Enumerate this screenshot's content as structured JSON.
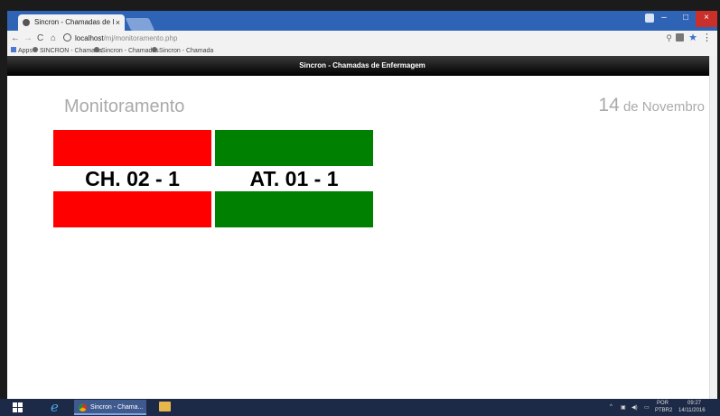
{
  "browser": {
    "tab_title": "Sincron - Chamadas de I",
    "tab_close": "×",
    "window_controls": {
      "minimize": "–",
      "maximize": "□",
      "close": "×"
    },
    "nav": {
      "back": "←",
      "forward": "→",
      "reload": "C",
      "home": "⌂"
    },
    "url_host": "localhost",
    "url_path": "/mj/monitoramento.php",
    "bookmarks": [
      "Apps",
      "SINCRON - Chamada",
      "Sincron - Chamadas",
      "Sincron - Chamada"
    ]
  },
  "page": {
    "header_title": "Sincron - Chamadas de Enfermagem",
    "title": "Monitoramento",
    "date_day": "14",
    "date_rest": " de Novembro"
  },
  "calls": [
    {
      "label": "CH. 02 - 1",
      "color": "#ff0000"
    },
    {
      "label": "AT. 01 - 1",
      "color": "#008000"
    }
  ],
  "taskbar": {
    "chrome_task": "Sincron - Chama...",
    "lang": "POR",
    "lang2": "PTBR2",
    "time": "09:27",
    "date": "14/11/2016"
  }
}
